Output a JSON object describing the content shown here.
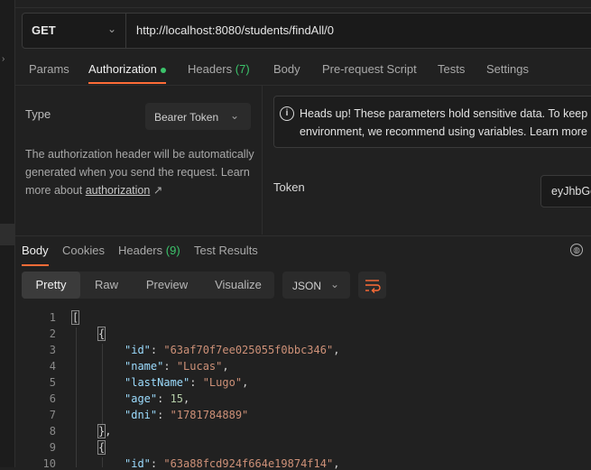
{
  "request": {
    "method": "GET",
    "url": "http://localhost:8080/students/findAll/0"
  },
  "request_tabs": [
    {
      "label": "Params"
    },
    {
      "label": "Authorization",
      "active": true
    },
    {
      "label": "Headers",
      "count": "(7)"
    },
    {
      "label": "Body"
    },
    {
      "label": "Pre-request Script"
    },
    {
      "label": "Tests"
    },
    {
      "label": "Settings"
    }
  ],
  "auth": {
    "type_label": "Type",
    "type_value": "Bearer Token",
    "description": "The authorization header will be automatically generated when you send the request. Learn more about",
    "link_text": "authorization",
    "link_arrow": "↗",
    "alert_line1": "Heads up! These parameters hold sensitive data. To keep",
    "alert_line2": "environment, we recommend using variables. Learn more",
    "token_label": "Token",
    "token_value": "eyJhbGc"
  },
  "response_tabs": [
    {
      "label": "Body",
      "active": true
    },
    {
      "label": "Cookies"
    },
    {
      "label": "Headers",
      "count": "(9)"
    },
    {
      "label": "Test Results"
    }
  ],
  "format_tabs": [
    {
      "label": "Pretty",
      "active": true
    },
    {
      "label": "Raw"
    },
    {
      "label": "Preview"
    },
    {
      "label": "Visualize"
    }
  ],
  "format_select": "JSON",
  "code_lines": [
    {
      "n": "1",
      "indent": 0,
      "parts": [
        {
          "t": "[",
          "c": "p bracket"
        }
      ]
    },
    {
      "n": "2",
      "indent": 1,
      "parts": [
        {
          "t": "{",
          "c": "p bracket"
        }
      ]
    },
    {
      "n": "3",
      "indent": 2,
      "parts": [
        {
          "t": "\"id\"",
          "c": "k"
        },
        {
          "t": ": ",
          "c": "p"
        },
        {
          "t": "\"63af70f7ee025055f0bbc346\"",
          "c": "s"
        },
        {
          "t": ",",
          "c": "p"
        }
      ]
    },
    {
      "n": "4",
      "indent": 2,
      "parts": [
        {
          "t": "\"name\"",
          "c": "k"
        },
        {
          "t": ": ",
          "c": "p"
        },
        {
          "t": "\"Lucas\"",
          "c": "s"
        },
        {
          "t": ",",
          "c": "p"
        }
      ]
    },
    {
      "n": "5",
      "indent": 2,
      "parts": [
        {
          "t": "\"lastName\"",
          "c": "k"
        },
        {
          "t": ": ",
          "c": "p"
        },
        {
          "t": "\"Lugo\"",
          "c": "s"
        },
        {
          "t": ",",
          "c": "p"
        }
      ]
    },
    {
      "n": "6",
      "indent": 2,
      "parts": [
        {
          "t": "\"age\"",
          "c": "k"
        },
        {
          "t": ": ",
          "c": "p"
        },
        {
          "t": "15",
          "c": "n"
        },
        {
          "t": ",",
          "c": "p"
        }
      ]
    },
    {
      "n": "7",
      "indent": 2,
      "parts": [
        {
          "t": "\"dni\"",
          "c": "k"
        },
        {
          "t": ": ",
          "c": "p"
        },
        {
          "t": "\"1781784889\"",
          "c": "s"
        }
      ]
    },
    {
      "n": "8",
      "indent": 1,
      "parts": [
        {
          "t": "}",
          "c": "p bracket"
        },
        {
          "t": ",",
          "c": "p"
        }
      ]
    },
    {
      "n": "9",
      "indent": 1,
      "parts": [
        {
          "t": "{",
          "c": "p bracket"
        }
      ]
    },
    {
      "n": "10",
      "indent": 2,
      "parts": [
        {
          "t": "\"id\"",
          "c": "k"
        },
        {
          "t": ": ",
          "c": "p"
        },
        {
          "t": "\"63a88fcd924f664e19874f14\"",
          "c": "s"
        },
        {
          "t": ",",
          "c": "p"
        }
      ]
    }
  ],
  "colors": {
    "background": "#212121",
    "accent": "#ff6c37",
    "count_green": "#3cc36b",
    "json_key": "#9cdcfe",
    "json_string": "#ce9178",
    "json_number": "#b5cea8"
  }
}
